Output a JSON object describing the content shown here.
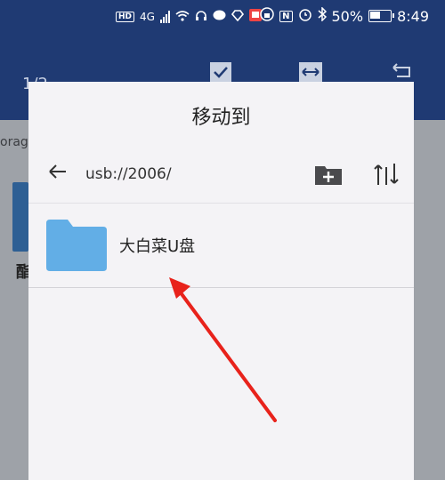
{
  "status_bar": {
    "hd": "HD",
    "network": "4G",
    "battery_text": "50%",
    "battery_level": 0.5,
    "time": "8:49"
  },
  "app_bar": {
    "counter": "1/2"
  },
  "background": {
    "path_fragment": "orag",
    "glyph": "酯"
  },
  "dialog": {
    "title": "移动到",
    "path": "usb://2006/",
    "items": [
      {
        "name": "大白菜U盘",
        "type": "folder",
        "icon": "folder-icon",
        "color": "#62aee6"
      }
    ]
  },
  "annotation": {
    "color": "#e8221b",
    "meaning": "red arrow pointing to folder"
  }
}
